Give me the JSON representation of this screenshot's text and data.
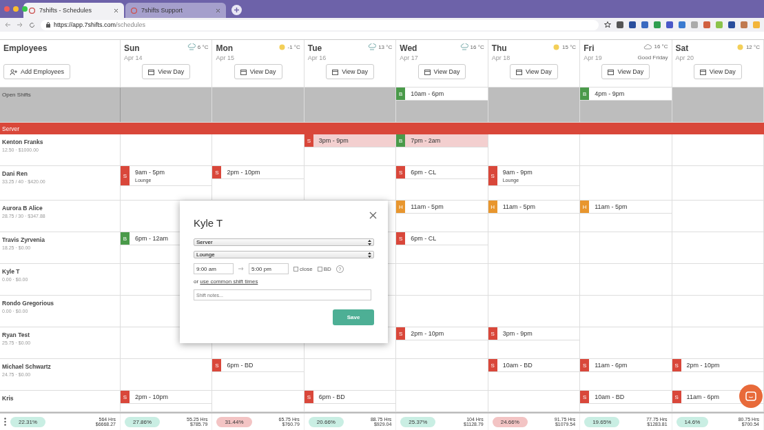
{
  "browser": {
    "tabs": [
      {
        "title": "7shifts - Schedules",
        "selected": true
      },
      {
        "title": "7shifts Support",
        "selected": false
      }
    ],
    "url_host": "https://app.7shifts.com",
    "url_path": "/schedules"
  },
  "header": {
    "employees_title": "Employees",
    "add_button": "Add Employees"
  },
  "days": [
    {
      "name": "Sun",
      "date": "Apr 14",
      "weather": {
        "kind": "rain"
      },
      "temp": "6 °C",
      "view": "View Day"
    },
    {
      "name": "Mon",
      "date": "Apr 15",
      "weather": {
        "kind": "sun"
      },
      "temp": "-1 °C",
      "view": "View Day"
    },
    {
      "name": "Tue",
      "date": "Apr 16",
      "weather": {
        "kind": "rain"
      },
      "temp": "13 °C",
      "view": "View Day"
    },
    {
      "name": "Wed",
      "date": "Apr 17",
      "weather": {
        "kind": "rain"
      },
      "temp": "16 °C",
      "view": "View Day"
    },
    {
      "name": "Thu",
      "date": "Apr 18",
      "weather": {
        "kind": "sun"
      },
      "temp": "15 °C",
      "view": "View Day"
    },
    {
      "name": "Fri",
      "date": "Apr 19",
      "weather": {
        "kind": "cloud"
      },
      "temp": "16 °C",
      "holiday": "Good Friday",
      "view": "View Day"
    },
    {
      "name": "Sat",
      "date": "Apr 20",
      "weather": {
        "kind": "sun"
      },
      "temp": "12 °C",
      "view": "View Day"
    }
  ],
  "open_shifts": {
    "label": "Open Shifts",
    "cells": [
      {},
      {},
      {},
      {
        "role": "B",
        "time": "10am - 6pm",
        "color": "#4a9a4a",
        "highlighted": false
      },
      {},
      {
        "role": "B",
        "time": "4pm - 9pm",
        "color": "#4a9a4a",
        "highlighted": false
      },
      {}
    ]
  },
  "department": "Server",
  "employees": [
    {
      "name": "Kenton Franks",
      "stats": "12.50 · $1000.00",
      "cells": [
        {},
        {},
        {
          "role": "S",
          "time": "3pm - 9pm",
          "color": "#d9473a",
          "highlighted": true
        },
        {
          "role": "B",
          "time": "7pm - 2am",
          "color": "#4a9a4a",
          "highlighted": true
        },
        {},
        {},
        {}
      ]
    },
    {
      "name": "Dani Ren",
      "stats": "33.25 / 40 · $420.00",
      "cells": [
        {
          "role": "S",
          "time": "9am - 5pm",
          "note": "Lounge",
          "color": "#d9473a",
          "highlighted": false
        },
        {
          "role": "S",
          "time": "2pm - 10pm",
          "color": "#d9473a",
          "highlighted": false
        },
        {},
        {
          "role": "S",
          "time": "6pm - CL",
          "color": "#d9473a",
          "highlighted": false
        },
        {
          "role": "S",
          "time": "9am - 9pm",
          "note": "Lounge",
          "color": "#d9473a",
          "highlighted": false
        },
        {},
        {}
      ]
    },
    {
      "name": "Aurora B Alice",
      "stats": "28.75 / 30 · $347.88",
      "cells": [
        {},
        {},
        {},
        {
          "role": "H",
          "time": "11am - 5pm",
          "color": "#e8962e",
          "highlighted": false
        },
        {
          "role": "H",
          "time": "11am - 5pm",
          "color": "#e8962e",
          "highlighted": false
        },
        {
          "role": "H",
          "time": "11am - 5pm",
          "color": "#e8962e",
          "highlighted": false
        },
        {}
      ]
    },
    {
      "name": "Travis Zyrvenia",
      "stats": "18.25 · $0.00",
      "cells": [
        {
          "role": "B",
          "time": "6pm - 12am",
          "color": "#4a9a4a",
          "highlighted": false
        },
        {},
        {},
        {
          "role": "S",
          "time": "6pm - CL",
          "color": "#d9473a",
          "highlighted": false
        },
        {},
        {},
        {}
      ]
    },
    {
      "name": "Kyle T",
      "stats": "0.00 · $0.00",
      "cells": [
        {},
        {},
        {},
        {},
        {},
        {},
        {}
      ]
    },
    {
      "name": "Rondo Gregorious",
      "stats": "0.00 · $0.00",
      "cells": [
        {},
        {},
        {},
        {},
        {},
        {},
        {}
      ]
    },
    {
      "name": "Ryan Test",
      "stats": "25.75 · $0.00",
      "cells": [
        {},
        {},
        {},
        {
          "role": "S",
          "time": "2pm - 10pm",
          "color": "#d9473a",
          "highlighted": false
        },
        {
          "role": "S",
          "time": "3pm - 9pm",
          "color": "#d9473a",
          "highlighted": false
        },
        {},
        {}
      ]
    },
    {
      "name": "Michael Schwartz",
      "stats": "24.75 · $0.00",
      "cells": [
        {},
        {
          "role": "S",
          "time": "6pm - BD",
          "color": "#d9473a",
          "highlighted": false
        },
        {},
        {},
        {
          "role": "S",
          "time": "10am - BD",
          "color": "#d9473a",
          "highlighted": false
        },
        {
          "role": "S",
          "time": "11am - 6pm",
          "color": "#d9473a",
          "highlighted": false
        },
        {
          "role": "S",
          "time": "2pm - 10pm",
          "color": "#d9473a",
          "highlighted": false
        }
      ]
    },
    {
      "name": "Kris",
      "cells": [
        {
          "role": "S",
          "time": "2pm - 10pm",
          "color": "#d9473a",
          "highlighted": false
        },
        {},
        {
          "role": "S",
          "time": "6pm - BD",
          "color": "#d9473a",
          "highlighted": false
        },
        {},
        {},
        {
          "role": "S",
          "time": "10am - BD",
          "color": "#d9473a",
          "highlighted": false
        },
        {
          "role": "S",
          "time": "11am - 6pm",
          "color": "#d9473a",
          "highlighted": false
        }
      ]
    }
  ],
  "totals": [
    {
      "percent": "22.31%",
      "color": "#c9eee3",
      "hours": "564 Hrs",
      "cost": "$6668.27"
    },
    {
      "percent": "27.86%",
      "color": "#c9eee3",
      "hours": "55.25 Hrs",
      "cost": "$785.79"
    },
    {
      "percent": "31.44%",
      "color": "#f3c4c4",
      "hours": "65.75 Hrs",
      "cost": "$760.79"
    },
    {
      "percent": "20.66%",
      "color": "#c9eee3",
      "hours": "88.75 Hrs",
      "cost": "$929.04"
    },
    {
      "percent": "25.37%",
      "color": "#c9eee3",
      "hours": "104 Hrs",
      "cost": "$1128.79"
    },
    {
      "percent": "24.66%",
      "color": "#f3c4c4",
      "hours": "91.75 Hrs",
      "cost": "$1079.54"
    },
    {
      "percent": "19.65%",
      "color": "#c9eee3",
      "hours": "77.75 Hrs",
      "cost": "$1283.81"
    },
    {
      "percent": "14.6%",
      "color": "#c9eee3",
      "hours": "80.75 Hrs",
      "cost": "$700.54"
    }
  ],
  "modal": {
    "title": "Kyle T",
    "role_select": "Server",
    "location_select": "Lounge",
    "start": "9:00 am",
    "end": "5:00 pm",
    "close_label": "close",
    "close_checked": false,
    "bd_label": "BD",
    "bd_checked": false,
    "help": "?",
    "or_text": "or",
    "common_link": "use common shift times",
    "notes_placeholder": "Shift notes...",
    "save": "Save"
  }
}
